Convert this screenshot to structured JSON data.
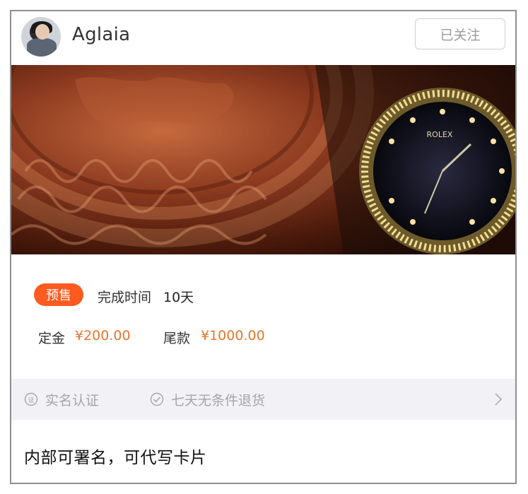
{
  "header": {
    "username": "Aglaia",
    "follow_label": "已关注"
  },
  "banner": {
    "watch_brand_text": "ROLEX"
  },
  "info": {
    "presale_tag": "预售",
    "finish_time_label": "完成时间",
    "finish_time_value": "10天",
    "deposit_label": "定金",
    "deposit_value": "¥200.00",
    "balance_label": "尾款",
    "balance_value": "¥1000.00"
  },
  "guarantees": {
    "items": [
      {
        "icon": "verified-badge-icon",
        "label": "实名认证"
      },
      {
        "icon": "check-circle-icon",
        "label": "七天无条件退货"
      }
    ],
    "chevron_icon": "chevron-right-icon"
  },
  "note": {
    "text": "内部可署名，可代写卡片"
  },
  "colors": {
    "accent_orange": "#ff5a1f",
    "price_orange": "#e8742c",
    "guarantee_bg": "#f2f2f6",
    "muted_text": "#a6a6a6"
  }
}
